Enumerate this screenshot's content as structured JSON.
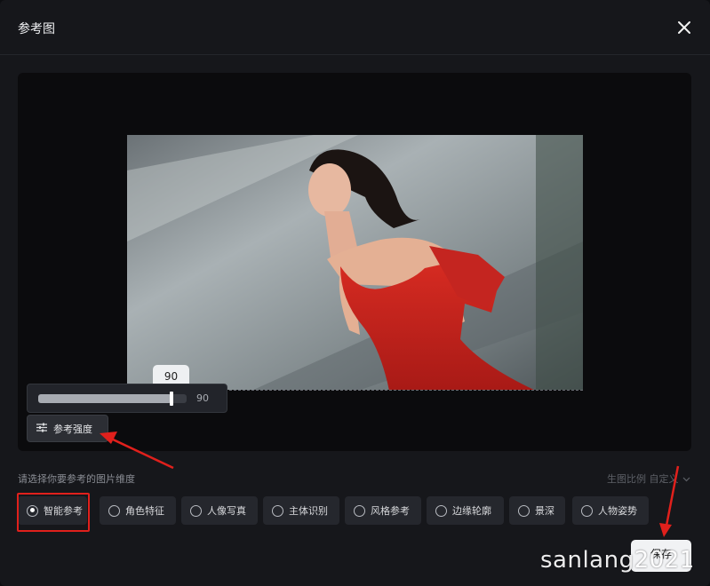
{
  "dialog": {
    "title": "参考图",
    "close_icon": "close-icon"
  },
  "slider": {
    "value": 90,
    "value_text": "90",
    "tooltip_text": "90",
    "max": 100
  },
  "strength_button": {
    "label": "参考强度",
    "icon": "sliders-icon"
  },
  "dimensions": {
    "prompt": "请选择你要参考的图片维度",
    "ratio_label": "生图比例 自定义",
    "options": [
      {
        "label": "智能参考",
        "selected": true
      },
      {
        "label": "角色特征",
        "selected": false
      },
      {
        "label": "人像写真",
        "selected": false
      },
      {
        "label": "主体识别",
        "selected": false
      },
      {
        "label": "风格参考",
        "selected": false
      },
      {
        "label": "边缘轮廓",
        "selected": false
      },
      {
        "label": "景深",
        "selected": false
      },
      {
        "label": "人物姿势",
        "selected": false
      }
    ]
  },
  "footer": {
    "save_label": "保存"
  },
  "watermark": "sanlang2021",
  "colors": {
    "annotation": "#e0201c",
    "dress": "#c9241e"
  }
}
